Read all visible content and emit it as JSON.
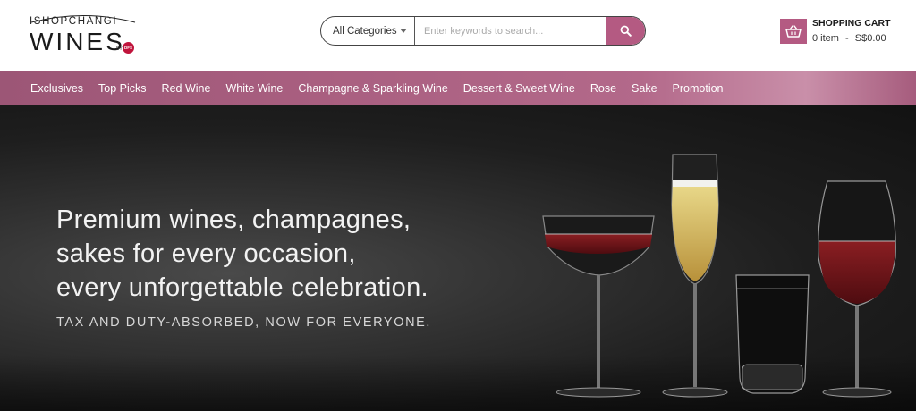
{
  "header": {
    "logo": {
      "top": "ISHOPCHANGI",
      "main": "WINES",
      "by": "BY",
      "badge": "DFS"
    },
    "search": {
      "category": "All Categories",
      "placeholder": "Enter keywords to search...",
      "button_icon": "search-icon"
    },
    "cart": {
      "title": "SHOPPING CART",
      "count": "0 item",
      "separator": "-",
      "total": "S$0.00",
      "icon": "basket-icon"
    }
  },
  "nav": {
    "items": [
      "Exclusives",
      "Top Picks",
      "Red Wine",
      "White Wine",
      "Champagne & Sparkling Wine",
      "Dessert & Sweet Wine",
      "Rose",
      "Sake",
      "Promotion"
    ]
  },
  "hero": {
    "line1": "Premium wines, champagnes,",
    "line2": "sakes for every occasion,",
    "line3": "every unforgettable celebration.",
    "subtitle": "TAX AND DUTY-ABSORBED, NOW FOR EVERYONE."
  },
  "colors": {
    "accent": "#b45a82",
    "hero_bg": "#1e1e1e"
  }
}
